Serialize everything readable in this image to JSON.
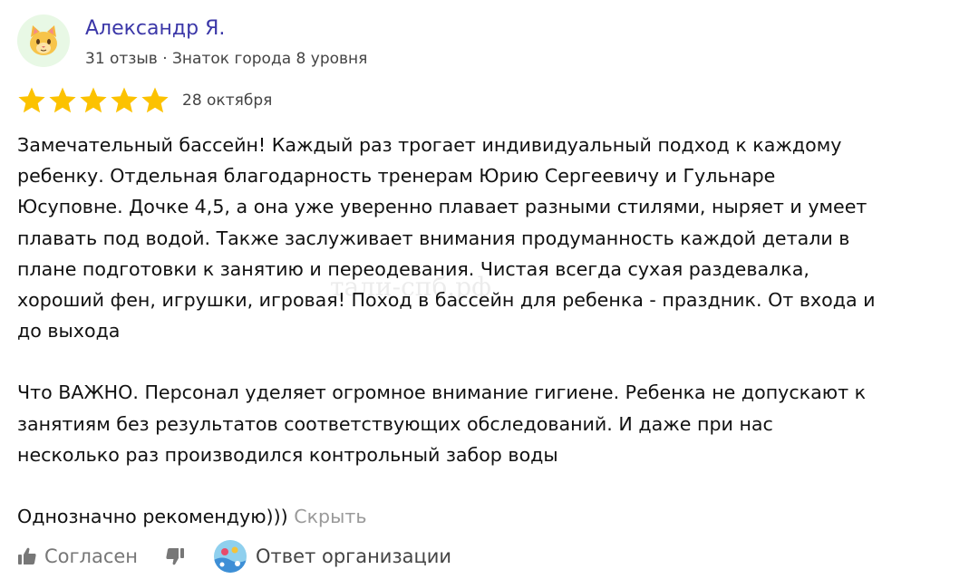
{
  "author": {
    "name": "Александр Я.",
    "meta": "31 отзыв · Знаток города 8 уровня",
    "avatar_icon": "cat-face-icon"
  },
  "rating": {
    "stars": 5,
    "max": 5,
    "date": "28 октября",
    "star_color": "#fcc200"
  },
  "review": {
    "paragraphs": [
      "Замечательный бассейн! Каждый раз трогает индивидуальный подход к каждому\nребенку. Отдельная благодарность тренерам Юрию Сергеевичу и Гульнаре\nЮсуповне. Дочке 4,5, а она уже уверенно плавает разными стилями, ныряет и умеет\nплавать под водой. Также заслуживает внимания продуманность каждой детали в\nплане подготовки к занятию и переодевания. Чистая всегда сухая раздевалка,\nхороший фен, игрушки, игровая! Поход в бассейн для ребенка - праздник. От входа и\nдо выхода",
      "Что ВАЖНО. Персонал уделяет огромное внимание гигиене. Ребенка не допускают к\nзанятиям без результатов соответствующих обследований. И даже при нас\nнесколько раз производился контрольный забор воды",
      "Однозначно рекомендую)))"
    ],
    "collapse_label": "Скрыть"
  },
  "watermark": "тали-спб.рф",
  "actions": {
    "like_label": "Согласен",
    "like_icon": "thumbs-up-icon",
    "dislike_icon": "thumbs-down-icon",
    "org_reply_label": "Ответ организации",
    "org_avatar_icon": "organization-logo-icon"
  }
}
